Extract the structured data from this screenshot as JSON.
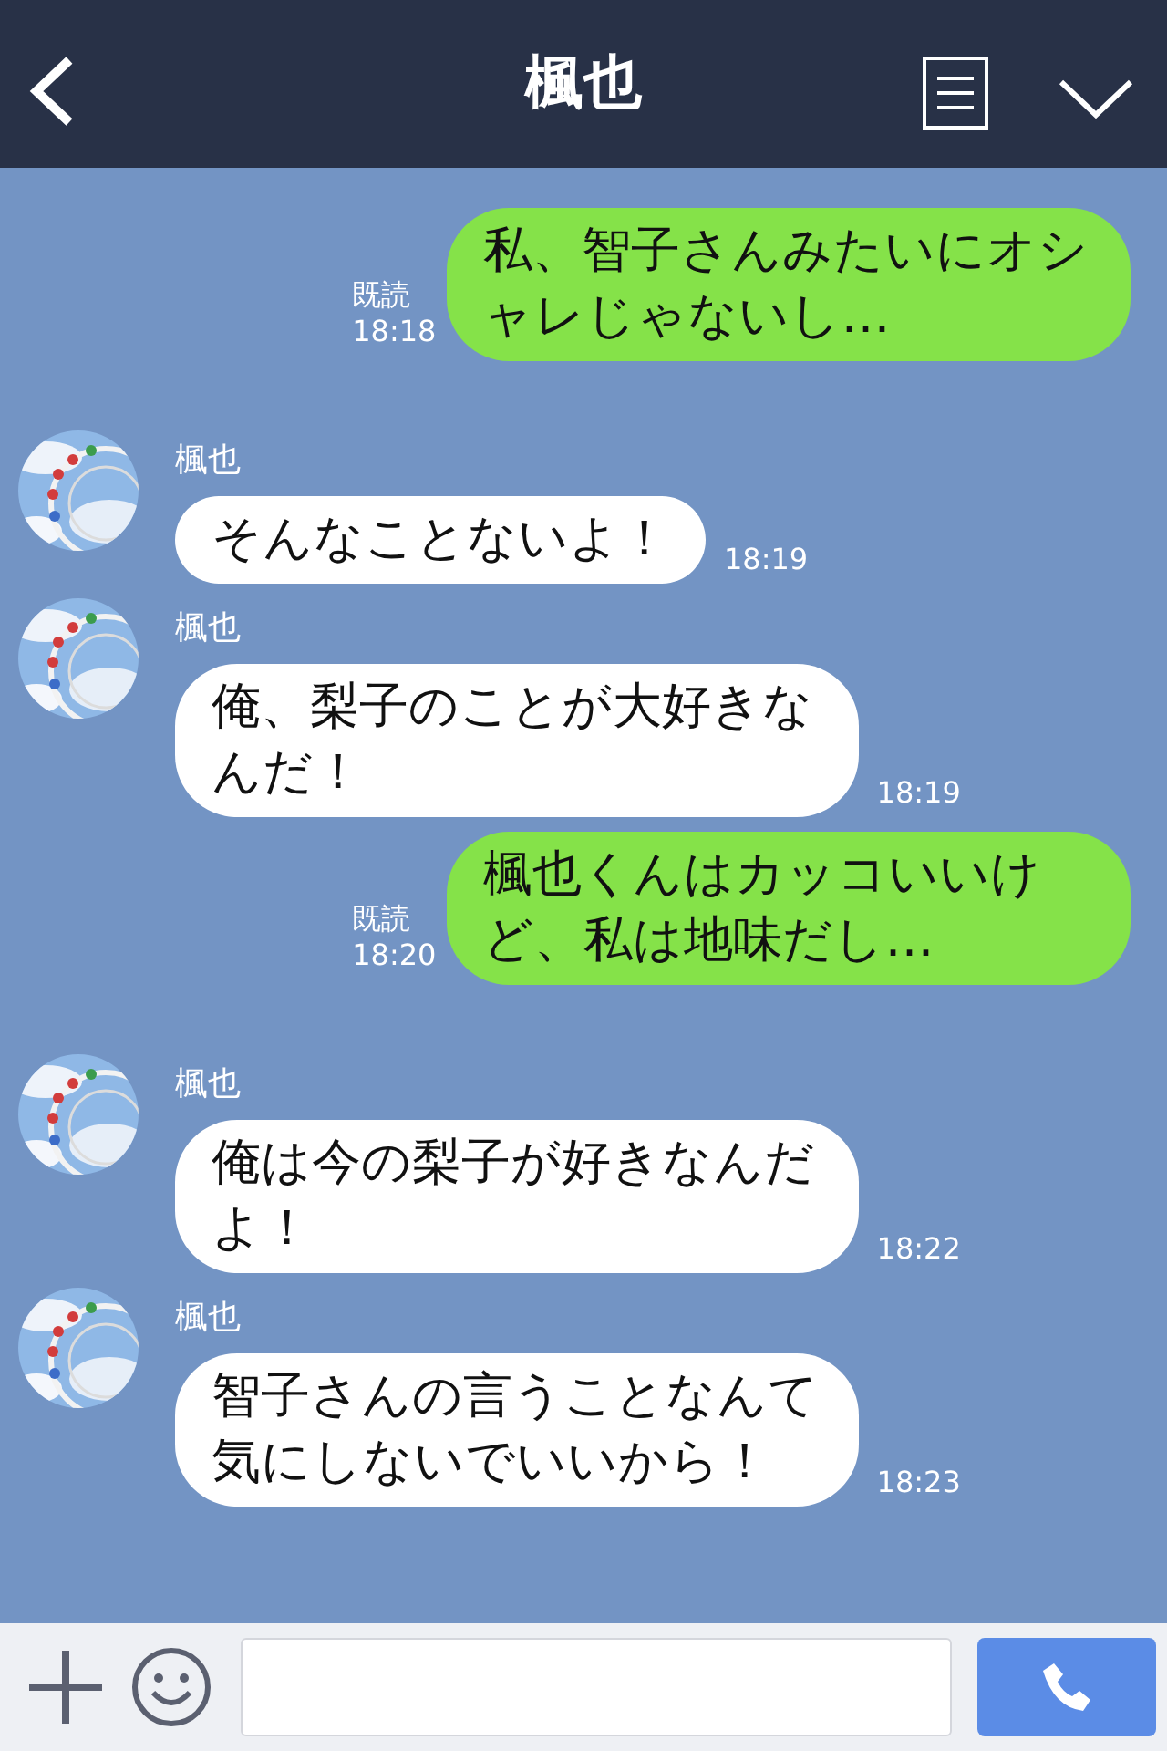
{
  "header": {
    "title": "楓也"
  },
  "messages": [
    {
      "kind": "sent",
      "text": "私、智子さんみたいにオシャレじゃないし…",
      "read": "既読",
      "time": "18:18"
    },
    {
      "kind": "received",
      "sender": "楓也",
      "text": "そんなことないよ！",
      "time": "18:19"
    },
    {
      "kind": "received",
      "sender": "楓也",
      "text": "俺、梨子のことが大好きなんだ！",
      "time": "18:19"
    },
    {
      "kind": "sent",
      "text": "楓也くんはカッコいいけど、私は地味だし…",
      "read": "既読",
      "time": "18:20"
    },
    {
      "kind": "received",
      "sender": "楓也",
      "text": "俺は今の梨子が好きなんだよ！",
      "time": "18:22"
    },
    {
      "kind": "received",
      "sender": "楓也",
      "text": "智子さんの言うことなんて気にしないでいいから！",
      "time": "18:23"
    }
  ]
}
